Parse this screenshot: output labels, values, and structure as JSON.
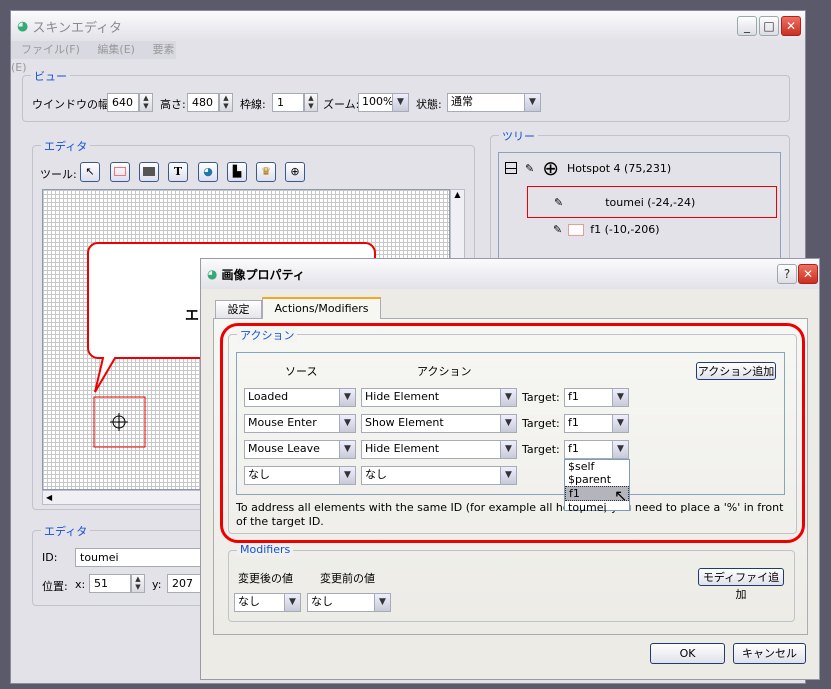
{
  "main_window": {
    "title": "スキンエディタ",
    "menu": [
      "ファイル(F)",
      "編集(E)",
      "要素(E)"
    ]
  },
  "view": {
    "legend": "ビュー",
    "width_label": "ウインドウの幅:",
    "width": "640",
    "height_label": "高さ:",
    "height": "480",
    "border_label": "枠線:",
    "border": "1",
    "zoom_label": "ズーム:",
    "zoom": "100%",
    "state_label": "状態:",
    "state": "通常"
  },
  "editor": {
    "legend": "エディタ",
    "tools_label": "ツール:",
    "tools": [
      "select-icon",
      "rectangle-icon",
      "filled-rectangle-icon",
      "text-icon",
      "image-icon",
      "button-image-icon",
      "sprite-icon",
      "hotspot-icon"
    ],
    "canvas_text": "エ"
  },
  "tree": {
    "legend": "ツリー",
    "items": [
      {
        "label": "Hotspot 4 (75,231)"
      },
      {
        "label": "toumei (-24,-24)",
        "selected": true
      },
      {
        "label": "f1 (-10,-206)"
      }
    ]
  },
  "props": {
    "legend": "エディタ",
    "id_label": "ID:",
    "id": "toumei",
    "pos_label": "位置:",
    "x_label": "x:",
    "x": "51",
    "y_label": "y:",
    "y": "207"
  },
  "dialog": {
    "title": "画像プロパティ",
    "tabs": [
      {
        "label": "設定"
      },
      {
        "label": "Actions/Modifiers",
        "active": true
      }
    ],
    "actions": {
      "legend": "アクション",
      "source_header": "ソース",
      "action_header": "アクション",
      "add_button": "アクション追加",
      "target_label": "Target:",
      "rows": [
        {
          "source": "Loaded",
          "action": "Hide Element",
          "target": "f1"
        },
        {
          "source": "Mouse Enter",
          "action": "Show Element",
          "target": "f1"
        },
        {
          "source": "Mouse Leave",
          "action": "Hide Element",
          "target": "f1"
        },
        {
          "source": "なし",
          "action": "なし"
        }
      ],
      "dropdown_options": [
        "$self",
        "$parent",
        "f1",
        "toumei"
      ],
      "dropdown_highlighted": "f1",
      "note": "To address all elements with the same ID (for example all hotspots) you need to place a '%' in front of the target ID."
    },
    "modifiers": {
      "legend": "Modifiers",
      "after_label": "変更後の値",
      "before_label": "変更前の値",
      "after": "なし",
      "before": "なし",
      "add_button": "モディファイ追加"
    },
    "ok": "OK",
    "cancel": "キャンセル"
  },
  "colors": {
    "highlight_red": "#e00000",
    "legend_blue": "#1050d8",
    "desktop": "#5b5a6b"
  }
}
